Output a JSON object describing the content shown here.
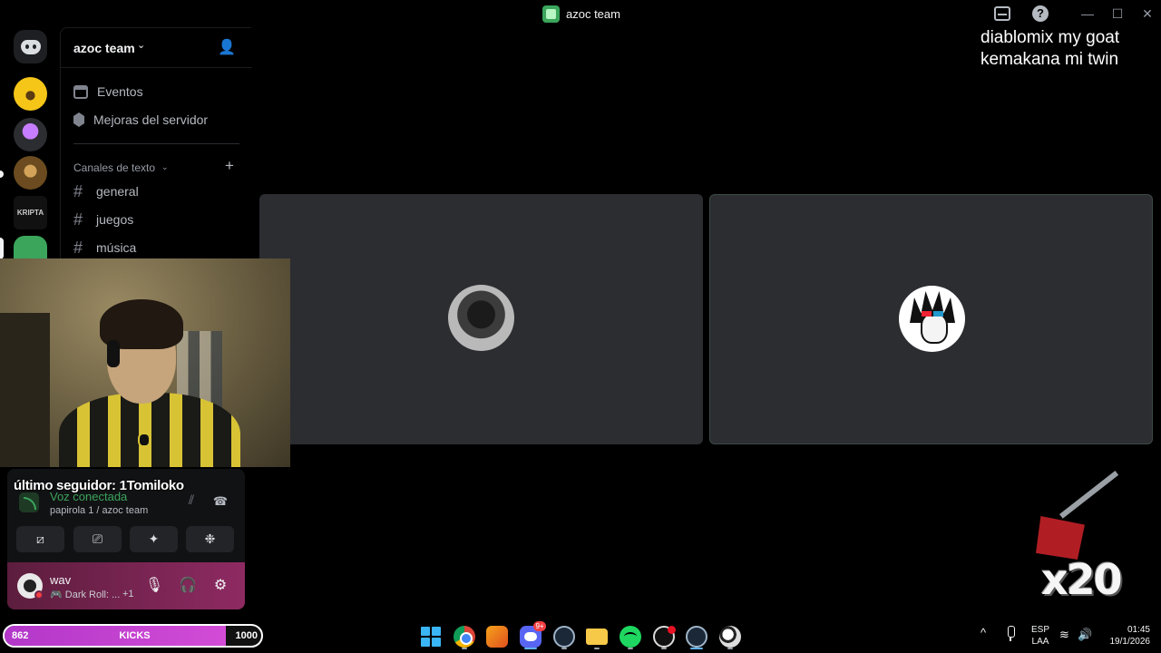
{
  "window": {
    "title": "azoc team",
    "minimize_glyph": "—",
    "maximize_glyph": "☐",
    "close_glyph": "✕",
    "help_glyph": "?"
  },
  "server": {
    "name": "azoc team",
    "links": [
      {
        "label": "Eventos",
        "icon": "calendar-icon"
      },
      {
        "label": "Mejoras del servidor",
        "icon": "boost-icon"
      }
    ],
    "category": "Canales de texto",
    "channels": [
      "general",
      "juegos",
      "música"
    ]
  },
  "server_rail": [
    {
      "name": "discord-home",
      "color": "#1e1f22"
    },
    {
      "name": "smiley-server",
      "color": "#f5c518"
    },
    {
      "name": "cup-server",
      "color": "#9b59b6"
    },
    {
      "name": "monkey-server",
      "color": "#8a6d2b"
    },
    {
      "name": "kripta-server",
      "color": "#111111",
      "label": "KRIPTA"
    },
    {
      "name": "azoc-server",
      "color": "#3ba55c"
    }
  ],
  "stream_overlay": {
    "follower_text": "último seguidor: 1Tomiloko",
    "chat_lines": [
      "diablomix my goat",
      "kemakana mi twin"
    ],
    "badge_text": "x20"
  },
  "voice": {
    "status": "Voz conectada",
    "location": "papirola 1 / azoc team",
    "buttons": [
      {
        "name": "camera-off-button",
        "glyph": "⧄"
      },
      {
        "name": "screen-share-button",
        "glyph": "⎚"
      },
      {
        "name": "activities-button",
        "glyph": "✦"
      },
      {
        "name": "soundboard-button",
        "glyph": "❉"
      }
    ]
  },
  "user": {
    "name": "wav",
    "activity": "🎮 Dark Roll: ...",
    "extra": "+1"
  },
  "kicks": {
    "current": "862",
    "label": "KICKS",
    "max": "1000",
    "progress": 0.862
  },
  "taskbar": {
    "discord_badge": "9+",
    "apps": [
      "start",
      "chrome",
      "fl-studio",
      "discord",
      "steam",
      "file-explorer",
      "spotify",
      "obs",
      "steam-2",
      "soccer-game"
    ]
  },
  "tray": {
    "lang_line1": "ESP",
    "lang_line2": "LAA",
    "time": "01:45",
    "date": "19/1/2026"
  }
}
